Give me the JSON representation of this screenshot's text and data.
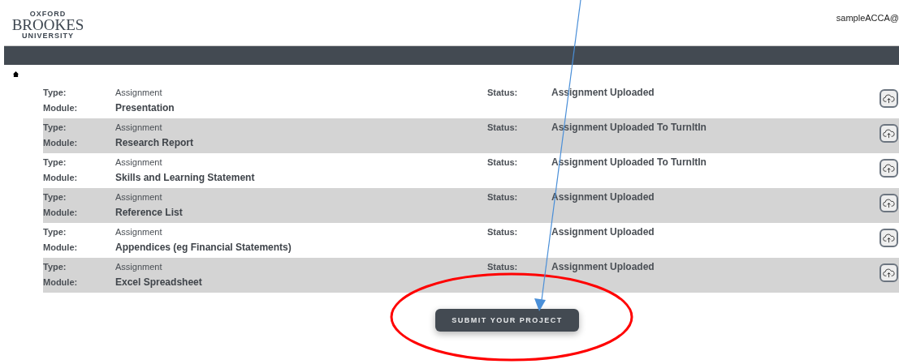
{
  "header": {
    "logo": {
      "top": "OXFORD",
      "middle": "BROOKES",
      "bottom": "UNIVERSITY"
    },
    "user": "sampleACCA@"
  },
  "submissions": [
    {
      "type_label": "Type:",
      "type": "Assignment",
      "module_label": "Module:",
      "module": "Presentation",
      "status_label": "Status:",
      "status": "Assignment Uploaded"
    },
    {
      "type_label": "Type:",
      "type": "Assignment",
      "module_label": "Module:",
      "module": "Research Report",
      "status_label": "Status:",
      "status": "Assignment Uploaded To TurnItIn"
    },
    {
      "type_label": "Type:",
      "type": "Assignment",
      "module_label": "Module:",
      "module": "Skills and Learning Statement",
      "status_label": "Status:",
      "status": "Assignment Uploaded To TurnItIn"
    },
    {
      "type_label": "Type:",
      "type": "Assignment",
      "module_label": "Module:",
      "module": "Reference List",
      "status_label": "Status:",
      "status": "Assignment Uploaded"
    },
    {
      "type_label": "Type:",
      "type": "Assignment",
      "module_label": "Module:",
      "module": "Appendices (eg Financial Statements)",
      "status_label": "Status:",
      "status": "Assignment Uploaded"
    },
    {
      "type_label": "Type:",
      "type": "Assignment",
      "module_label": "Module:",
      "module": "Excel Spreadsheet",
      "status_label": "Status:",
      "status": "Assignment Uploaded"
    }
  ],
  "submit_button": "SUBMIT YOUR PROJECT"
}
